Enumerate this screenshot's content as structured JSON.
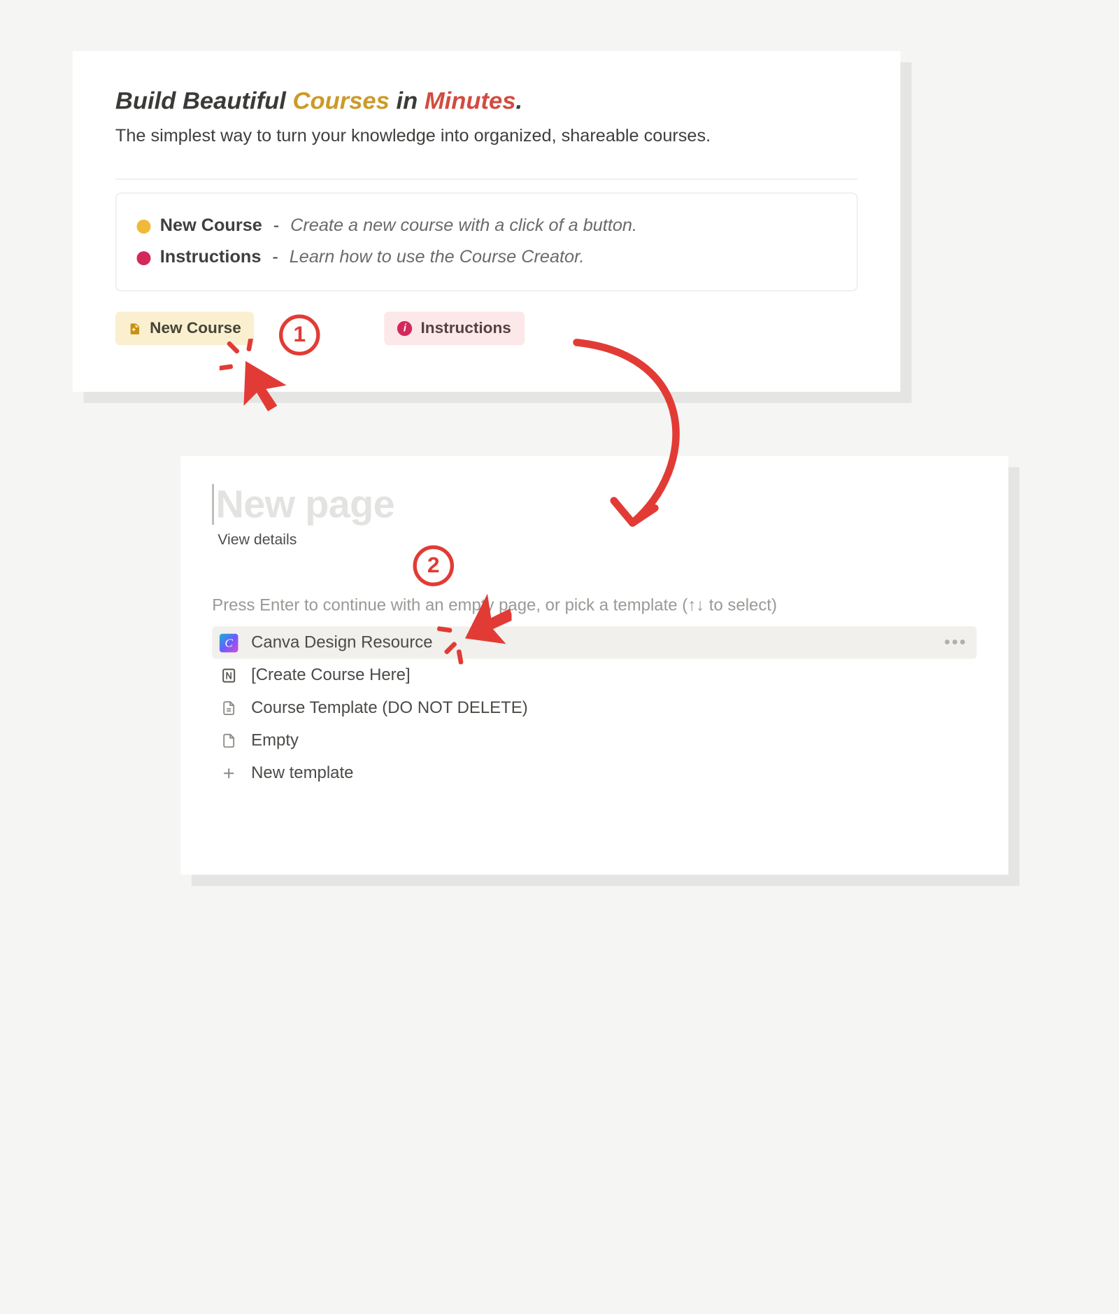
{
  "card1": {
    "headline": {
      "part1": "Build Beautiful ",
      "courses": "Courses",
      "part2": " in ",
      "minutes": "Minutes",
      "period": "."
    },
    "subline": "The simplest way to turn your knowledge into organized, shareable courses.",
    "info": {
      "row1": {
        "title": "New Course",
        "desc": "Create a new course with a click of a button."
      },
      "row2": {
        "title": "Instructions",
        "desc": "Learn how to use the Course Creator."
      }
    },
    "buttons": {
      "new_course": "New Course",
      "instructions": "Instructions"
    }
  },
  "card2": {
    "title": "New page",
    "view_details": "View details",
    "hint": "Press Enter to continue with an empty page, or pick a template (↑↓ to select)",
    "templates": {
      "t0": "Canva Design Resource",
      "t1": "[Create Course Here]",
      "t2": "Course Template (DO NOT DELETE)",
      "t3": "Empty",
      "t4": "New template"
    },
    "more": "•••"
  },
  "annotations": {
    "step1": "1",
    "step2": "2"
  }
}
